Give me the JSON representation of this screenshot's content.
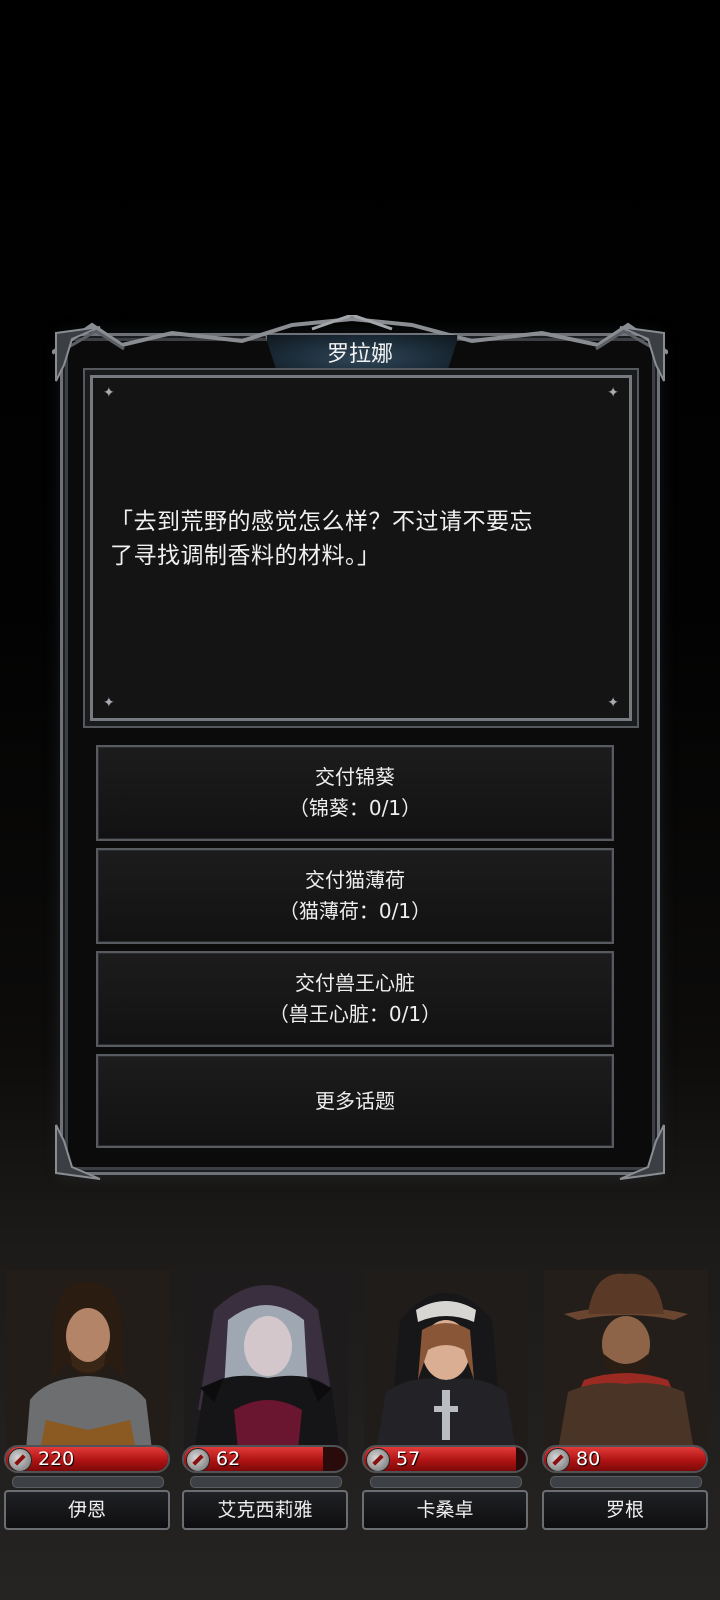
{
  "dialog": {
    "speaker": "罗拉娜",
    "text_line1": "「去到荒野的感觉怎么样？不过请不要忘",
    "text_line2": "了寻找调制香料的材料。」",
    "choices": [
      {
        "line1": "交付锦葵",
        "line2": "（锦葵：0/1）"
      },
      {
        "line1": "交付猫薄荷",
        "line2": "（猫薄荷：0/1）"
      },
      {
        "line1": "交付兽王心脏",
        "line2": "（兽王心脏：0/1）"
      },
      {
        "line1": "更多话题",
        "line2": ""
      }
    ]
  },
  "party": [
    {
      "name": "伊恩",
      "hp": "220",
      "hp_fraction": 1.0
    },
    {
      "name": "艾克西莉雅",
      "hp": "62",
      "hp_fraction": 0.86
    },
    {
      "name": "卡桑卓",
      "hp": "57",
      "hp_fraction": 0.94
    },
    {
      "name": "罗根",
      "hp": "80",
      "hp_fraction": 1.0
    }
  ],
  "colors": {
    "hp_red": "#c41c1c",
    "frame_silver": "#6e7278",
    "title_blue": "#2f4658"
  }
}
